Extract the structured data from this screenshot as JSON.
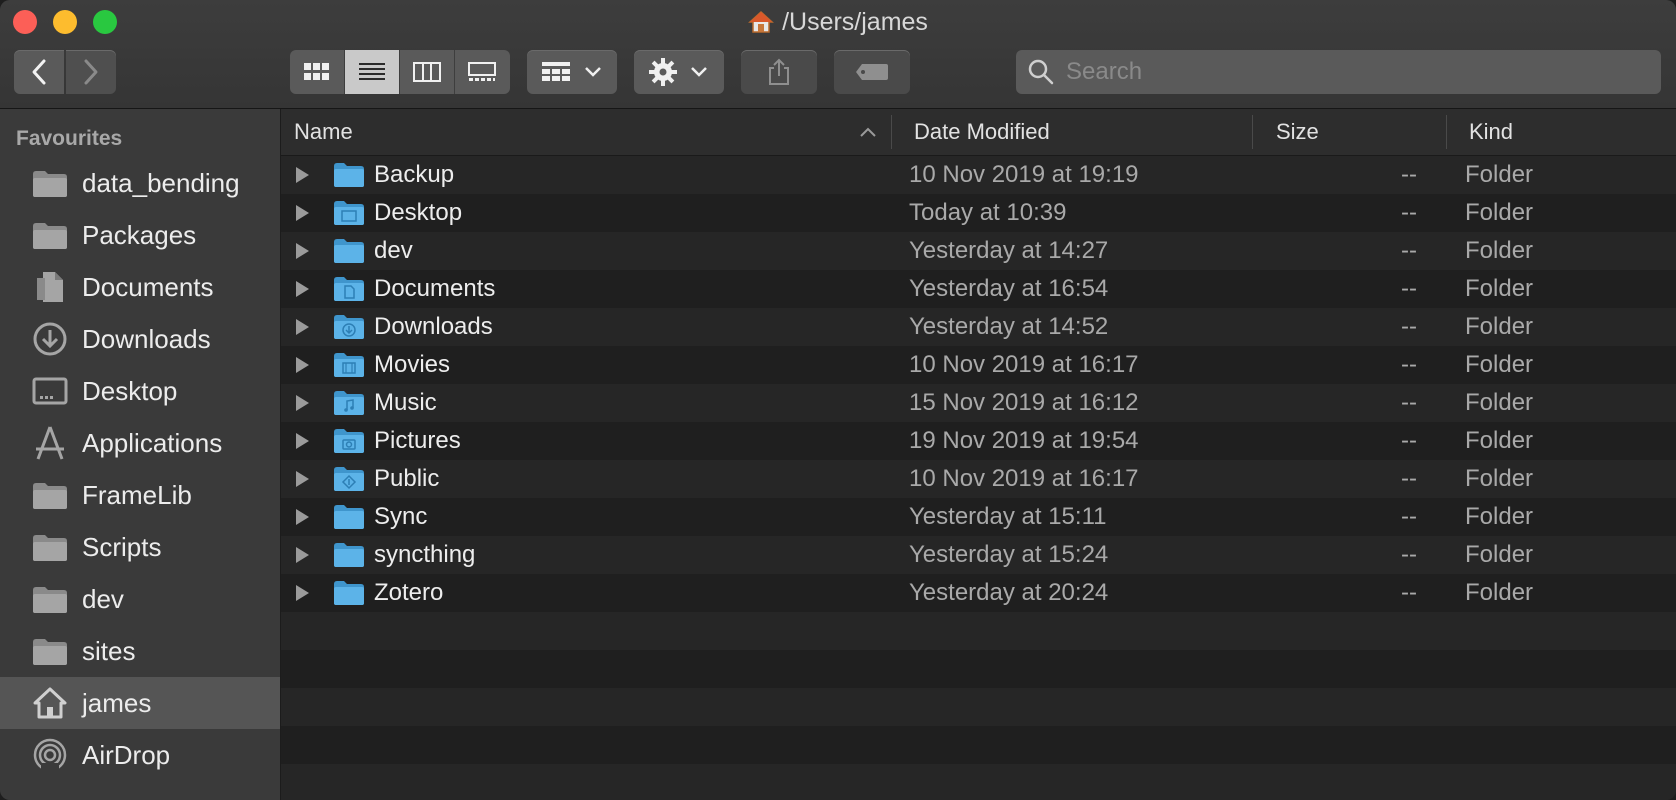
{
  "window": {
    "title": "/Users/james",
    "title_icon": "home-icon"
  },
  "toolbar": {
    "back_icon": "chevron-left-icon",
    "forward_icon": "chevron-right-icon",
    "view_modes": [
      "icon-view",
      "list-view",
      "column-view",
      "gallery-view"
    ],
    "active_view": "list-view",
    "group_icon": "group-by-icon",
    "action_icon": "gear-icon",
    "share_icon": "share-icon",
    "tags_icon": "tag-icon",
    "search_placeholder": "Search"
  },
  "sidebar": {
    "heading": "Favourites",
    "items": [
      {
        "label": "data_bending",
        "icon": "folder-icon"
      },
      {
        "label": "Packages",
        "icon": "folder-icon"
      },
      {
        "label": "Documents",
        "icon": "documents-icon"
      },
      {
        "label": "Downloads",
        "icon": "downloads-icon"
      },
      {
        "label": "Desktop",
        "icon": "desktop-icon"
      },
      {
        "label": "Applications",
        "icon": "applications-icon"
      },
      {
        "label": "FrameLib",
        "icon": "folder-icon"
      },
      {
        "label": "Scripts",
        "icon": "folder-icon"
      },
      {
        "label": "dev",
        "icon": "folder-icon"
      },
      {
        "label": "sites",
        "icon": "folder-icon"
      },
      {
        "label": "james",
        "icon": "home-icon",
        "selected": true
      },
      {
        "label": "AirDrop",
        "icon": "airdrop-icon"
      }
    ]
  },
  "columns": {
    "name": "Name",
    "date": "Date Modified",
    "size": "Size",
    "kind": "Kind"
  },
  "files": [
    {
      "name": "Backup",
      "date": "10 Nov 2019 at 19:19",
      "size": "--",
      "kind": "Folder",
      "icon": "folder-icon"
    },
    {
      "name": "Desktop",
      "date": "Today at 10:39",
      "size": "--",
      "kind": "Folder",
      "icon": "desktop-folder-icon"
    },
    {
      "name": "dev",
      "date": "Yesterday at 14:27",
      "size": "--",
      "kind": "Folder",
      "icon": "folder-icon"
    },
    {
      "name": "Documents",
      "date": "Yesterday at 16:54",
      "size": "--",
      "kind": "Folder",
      "icon": "documents-folder-icon"
    },
    {
      "name": "Downloads",
      "date": "Yesterday at 14:52",
      "size": "--",
      "kind": "Folder",
      "icon": "downloads-folder-icon"
    },
    {
      "name": "Movies",
      "date": "10 Nov 2019 at 16:17",
      "size": "--",
      "kind": "Folder",
      "icon": "movies-folder-icon"
    },
    {
      "name": "Music",
      "date": "15 Nov 2019 at 16:12",
      "size": "--",
      "kind": "Folder",
      "icon": "music-folder-icon"
    },
    {
      "name": "Pictures",
      "date": "19 Nov 2019 at 19:54",
      "size": "--",
      "kind": "Folder",
      "icon": "pictures-folder-icon"
    },
    {
      "name": "Public",
      "date": "10 Nov 2019 at 16:17",
      "size": "--",
      "kind": "Folder",
      "icon": "public-folder-icon"
    },
    {
      "name": "Sync",
      "date": "Yesterday at 15:11",
      "size": "--",
      "kind": "Folder",
      "icon": "folder-icon"
    },
    {
      "name": "syncthing",
      "date": "Yesterday at 15:24",
      "size": "--",
      "kind": "Folder",
      "icon": "folder-icon"
    },
    {
      "name": "Zotero",
      "date": "Yesterday at 20:24",
      "size": "--",
      "kind": "Folder",
      "icon": "folder-icon"
    }
  ],
  "colors": {
    "folder_blue": "#5cb3e8",
    "folder_blue_dark": "#3f95cc",
    "selected_sidebar": "#555555"
  }
}
